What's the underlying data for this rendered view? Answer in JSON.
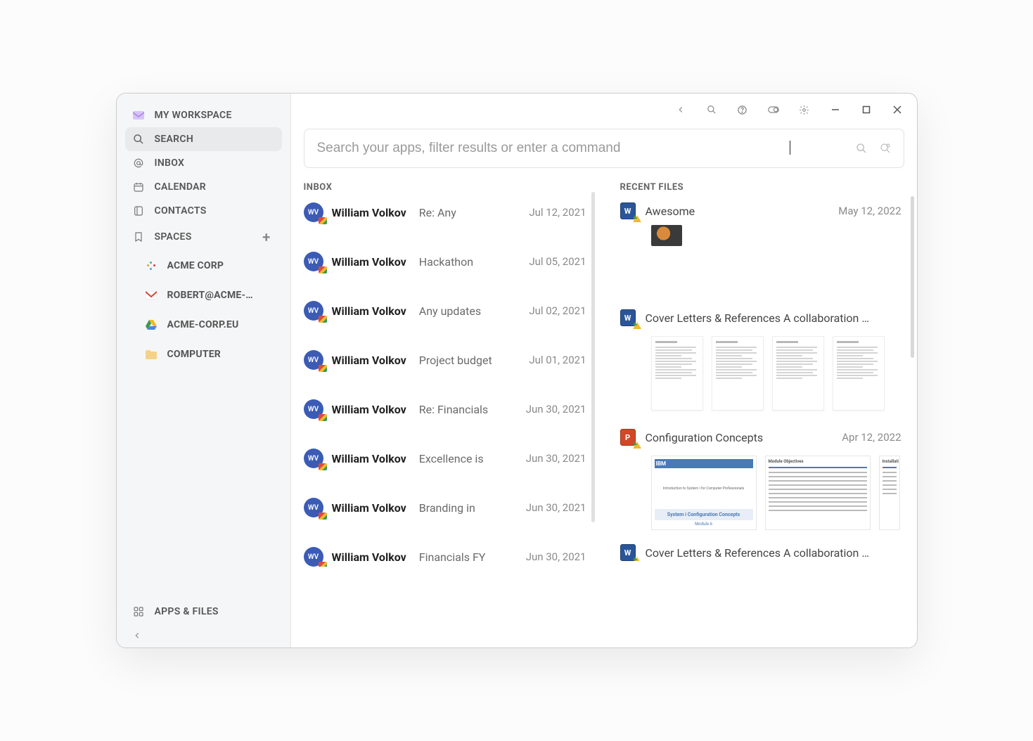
{
  "sidebar": {
    "workspace_label": "MY WORKSPACE",
    "items": [
      {
        "id": "search",
        "label": "SEARCH"
      },
      {
        "id": "inbox",
        "label": "INBOX"
      },
      {
        "id": "calendar",
        "label": "CALENDAR"
      },
      {
        "id": "contacts",
        "label": "CONTACTS"
      },
      {
        "id": "spaces",
        "label": "SPACES"
      }
    ],
    "active_id": "search",
    "spaces": [
      {
        "id": "acme",
        "label": "ACME CORP",
        "icon": "slack"
      },
      {
        "id": "robert",
        "label": "ROBERT@ACME-…",
        "icon": "gmail"
      },
      {
        "id": "acmecorp",
        "label": "ACME-CORP.EU",
        "icon": "drive"
      },
      {
        "id": "computer",
        "label": "COMPUTER",
        "icon": "folder"
      }
    ],
    "apps_files_label": "APPS & FILES"
  },
  "search": {
    "placeholder": "Search your apps, filter results or enter a command",
    "value": ""
  },
  "inbox": {
    "header": "INBOX",
    "avatar_initials": "WV",
    "messages": [
      {
        "sender": "William Volkov",
        "subject": "Re: Any",
        "date": "Jul 12, 2021"
      },
      {
        "sender": "William Volkov",
        "subject": "Hackathon",
        "date": "Jul 05, 2021"
      },
      {
        "sender": "William Volkov",
        "subject": "Any updates",
        "date": "Jul 02, 2021"
      },
      {
        "sender": "William Volkov",
        "subject": "Project budget",
        "date": "Jul 01, 2021"
      },
      {
        "sender": "William Volkov",
        "subject": "Re: Financials",
        "date": "Jun 30, 2021"
      },
      {
        "sender": "William Volkov",
        "subject": "Excellence is",
        "date": "Jun 30, 2021"
      },
      {
        "sender": "William Volkov",
        "subject": "Branding in",
        "date": "Jun 30, 2021"
      },
      {
        "sender": "William Volkov",
        "subject": "Financials FY",
        "date": "Jun 30, 2021"
      }
    ]
  },
  "files": {
    "header": "RECENT FILES",
    "items": [
      {
        "type": "word",
        "name": "Awesome",
        "date": "May 12, 2022",
        "preview": "image"
      },
      {
        "type": "word",
        "name": "Cover Letters & References A collaboration …",
        "date": "",
        "preview": "docpages4"
      },
      {
        "type": "ppt",
        "name": "Configuration Concepts",
        "date": "Apr 12, 2022",
        "preview": "ppt"
      },
      {
        "type": "word",
        "name": "Cover Letters & References A collaboration …",
        "date": "",
        "preview": "none"
      }
    ],
    "ppt_preview": {
      "brand": "IBM",
      "slide1_sub": "Introduction to System i for Computer Professionals",
      "slide1_title": "System i Configuration Concepts",
      "slide1_module": "Module 6",
      "slide2_header": "Module Objectives",
      "slide3_header": "Installati"
    }
  }
}
